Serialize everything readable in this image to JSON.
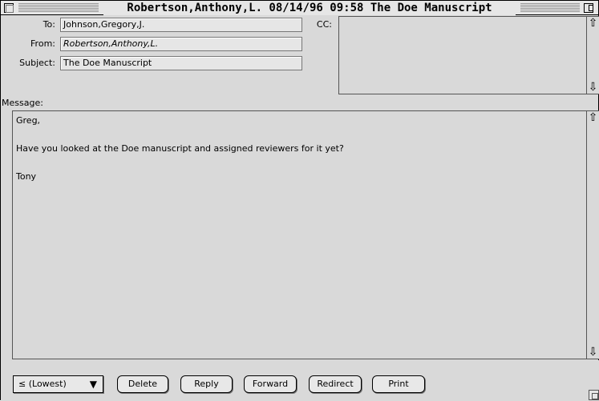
{
  "window": {
    "title": "Robertson,Anthony,L. 08/14/96 09:58 The Doe Manuscript"
  },
  "header": {
    "to_label": "To:",
    "to_value": "Johnson,Gregory,J.",
    "from_label": "From:",
    "from_value": "Robertson,Anthony,L.",
    "subject_label": "Subject:",
    "subject_value": "The Doe Manuscript",
    "cc_label": "CC:",
    "cc_value": ""
  },
  "message": {
    "label": "Message:",
    "body": "Greg,\n\nHave you looked at the Doe manuscript and assigned reviewers for it yet?\n\nTony"
  },
  "toolbar": {
    "priority": "≤ (Lowest)",
    "priority_arrow": "▼",
    "delete": "Delete",
    "reply": "Reply",
    "forward": "Forward",
    "redirect": "Redirect",
    "print": "Print"
  },
  "icons": {
    "scroll_up": "⇧",
    "scroll_down": "⇩"
  }
}
